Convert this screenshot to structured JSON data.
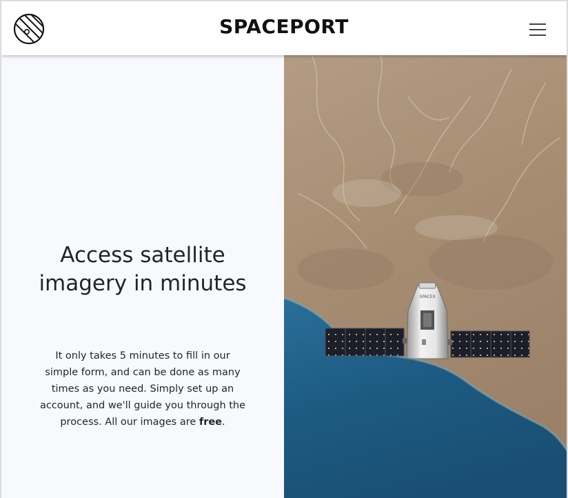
{
  "header": {
    "brand": "SPACEPORT",
    "logo_icon": "planet-icon",
    "menu_icon": "hamburger-menu-icon"
  },
  "hero": {
    "headline": "Access satellite imagery in minutes",
    "body_prefix": "It only takes 5 minutes to fill in our simple form, and can be done as many times as you need. Simply set up an account, and we'll guide you through the process. All our images are ",
    "body_emphasis": "free",
    "body_suffix": "."
  },
  "image": {
    "subject": "satellite-over-coastline-photo",
    "capsule_text": "SPACEX"
  },
  "colors": {
    "background": "#f8f9fc",
    "navbar": "#ffffff",
    "text": "#212529",
    "desert": "#a88f74",
    "ocean": "#1f5f86"
  }
}
